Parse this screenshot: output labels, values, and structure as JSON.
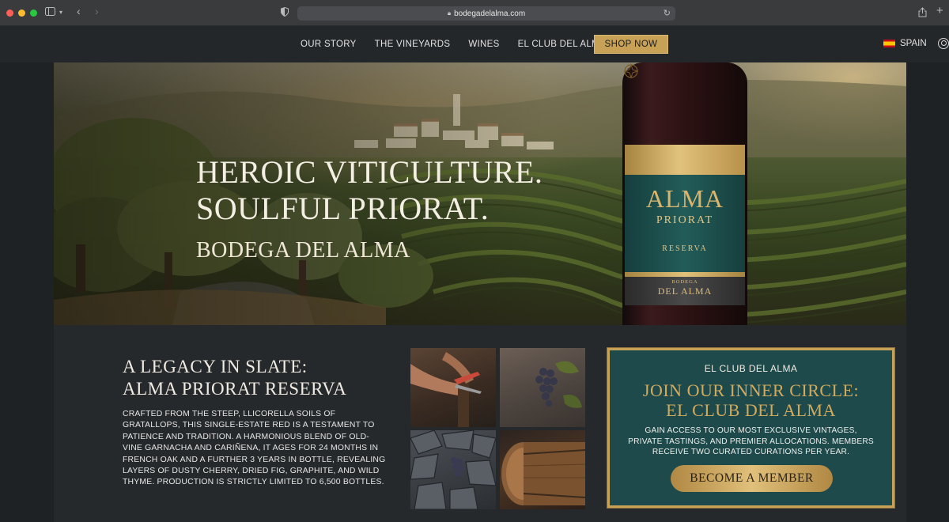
{
  "browser": {
    "url": "bodegadelalma.com"
  },
  "nav": {
    "links": [
      "OUR STORY",
      "THE VINEYARDS",
      "WINES",
      "EL CLUB DEL ALMA"
    ],
    "cta": "SHOP NOW",
    "language": "SPAIN"
  },
  "hero": {
    "title_line1": "HEROIC VITICULTURE.",
    "title_line2": "SOULFUL PRIORAT.",
    "subtitle": "BODEGA DEL ALMA",
    "bottle": {
      "brand": "ALMA",
      "region": "PRIORAT",
      "grade": "RESERVA",
      "producer_small": "BODEGA",
      "producer": "DEL ALMA"
    }
  },
  "legacy": {
    "title_line1": "A LEGACY IN SLATE:",
    "title_line2": "ALMA PRIORAT RESERVA",
    "body": "CRAFTED FROM THE STEEP, LLICORELLA SOILS OF GRATALLOPS, THIS SINGLE-ESTATE RED IS A TESTAMENT TO PATIENCE AND TRADITION. A HARMONIOUS BLEND OF OLD-VINE GARNACHA AND CARIÑENA, IT AGES FOR 24 MONTHS IN FRENCH OAK AND A FURTHER 3 YEARS IN BOTTLE, REVEALING LAYERS OF DUSTY CHERRY, DRIED FIG, GRAPHITE, AND WILD THYME. PRODUCTION IS STRICTLY LIMITED TO 6,500 BOTTLES."
  },
  "club": {
    "kicker": "EL CLUB DEL ALMA",
    "title_line1": "JOIN OUR INNER CIRCLE:",
    "title_line2": "EL CLUB DEL ALMA",
    "body": "GAIN ACCESS TO OUR MOST EXCLUSIVE VINTAGES, PRIVATE TASTINGS, AND PREMIER ALLOCATIONS. MEMBERS RECEIVE TWO CURATED CURATIONS PER YEAR.",
    "button": "BECOME A MEMBER"
  },
  "colors": {
    "gold": "#c7a156",
    "teal": "#1e4a4c",
    "background": "#26292c"
  },
  "icons": [
    "sidebar-icon",
    "chevron-down-icon",
    "back-icon",
    "forward-icon",
    "shield-icon",
    "lock-icon",
    "reload-icon",
    "share-icon",
    "new-tab-icon",
    "flag-spain-icon",
    "account-icon"
  ]
}
